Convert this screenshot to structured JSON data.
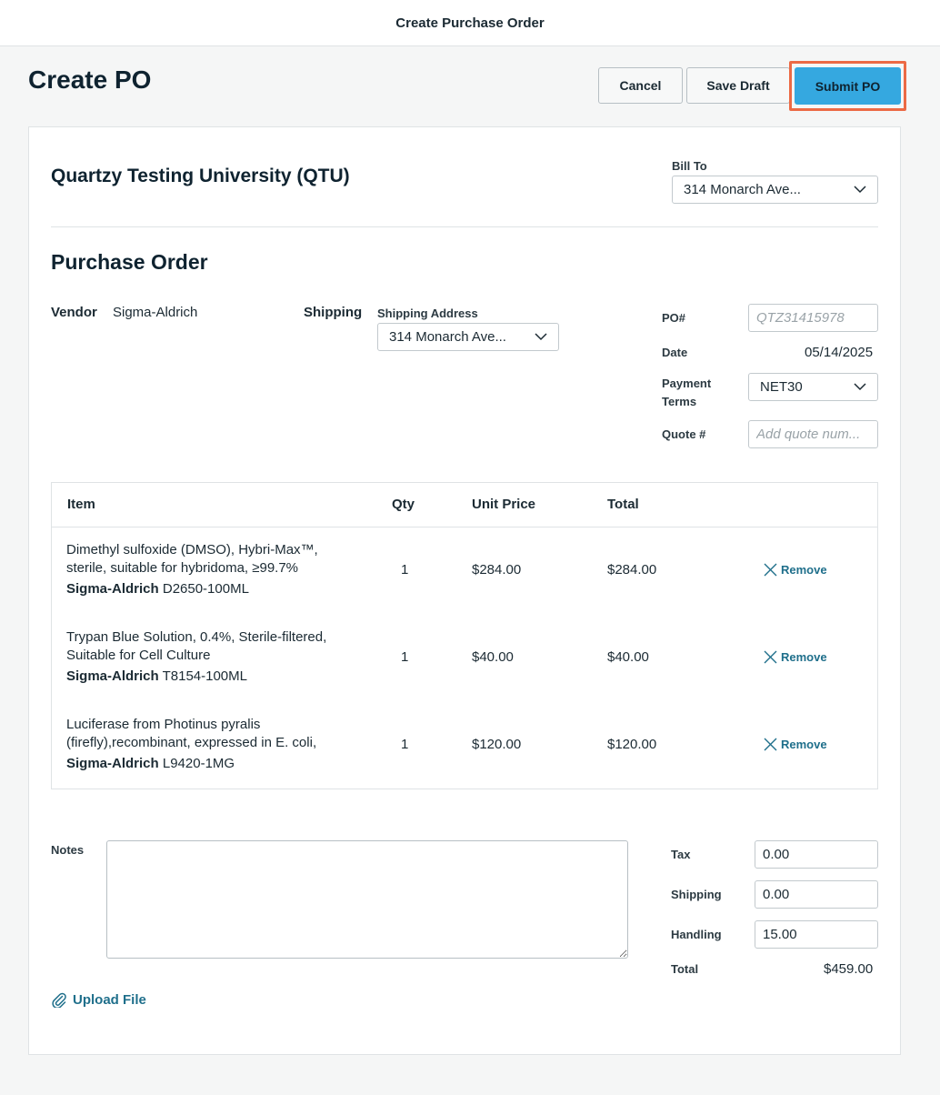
{
  "window": {
    "title": "Create Purchase Order"
  },
  "header": {
    "page_title": "Create PO",
    "cancel_label": "Cancel",
    "save_draft_label": "Save Draft",
    "submit_label": "Submit PO"
  },
  "org": {
    "name": "Quartzy Testing University (QTU)",
    "bill_to_label": "Bill To",
    "bill_to_value": "314 Monarch Ave..."
  },
  "po": {
    "section_title": "Purchase Order",
    "vendor_label": "Vendor",
    "vendor_value": "Sigma-Aldrich",
    "shipping_label": "Shipping",
    "shipping_address_label": "Shipping Address",
    "shipping_address_value": "314 Monarch Ave...",
    "po_number_label": "PO#",
    "po_number_placeholder": "QTZ31415978",
    "date_label": "Date",
    "date_value": "05/14/2025",
    "payment_terms_label_1": "Payment",
    "payment_terms_label_2": "Terms",
    "payment_terms_value": "NET30",
    "quote_label": "Quote #",
    "quote_placeholder": "Add quote num..."
  },
  "table": {
    "headers": {
      "item": "Item",
      "qty": "Qty",
      "unit_price": "Unit Price",
      "total": "Total"
    },
    "remove_label": "Remove",
    "rows": [
      {
        "desc_line1": "Dimethyl sulfoxide (DMSO), Hybri-Max™,",
        "desc_line2": "sterile, suitable for hybridoma, ≥99.7%",
        "vendor": "Sigma-Aldrich",
        "sku": "D2650-100ML",
        "qty": "1",
        "unit_price": "$284.00",
        "total": "$284.00"
      },
      {
        "desc_line1": "Trypan Blue Solution, 0.4%, Sterile-filtered,",
        "desc_line2": "Suitable for Cell Culture",
        "vendor": "Sigma-Aldrich",
        "sku": "T8154-100ML",
        "qty": "1",
        "unit_price": "$40.00",
        "total": "$40.00"
      },
      {
        "desc_line1": "Luciferase from Photinus pyralis",
        "desc_line2": "(firefly),recombinant, expressed in E. coli,",
        "vendor": "Sigma-Aldrich",
        "sku": "L9420-1MG",
        "qty": "1",
        "unit_price": "$120.00",
        "total": "$120.00"
      }
    ]
  },
  "footer": {
    "notes_label": "Notes",
    "notes_value": "",
    "upload_label": "Upload File",
    "tax_label": "Tax",
    "tax_value": "0.00",
    "shipping_label": "Shipping",
    "shipping_value": "0.00",
    "handling_label": "Handling",
    "handling_value": "15.00",
    "total_label": "Total",
    "total_value": "$459.00"
  },
  "icons": {
    "select_chevron": "chevron-down-icon",
    "remove": "close-icon",
    "upload": "paperclip-icon"
  },
  "colors": {
    "primary": "#35a8e0",
    "highlight": "#ec6a45",
    "link": "#1f6f8b"
  }
}
